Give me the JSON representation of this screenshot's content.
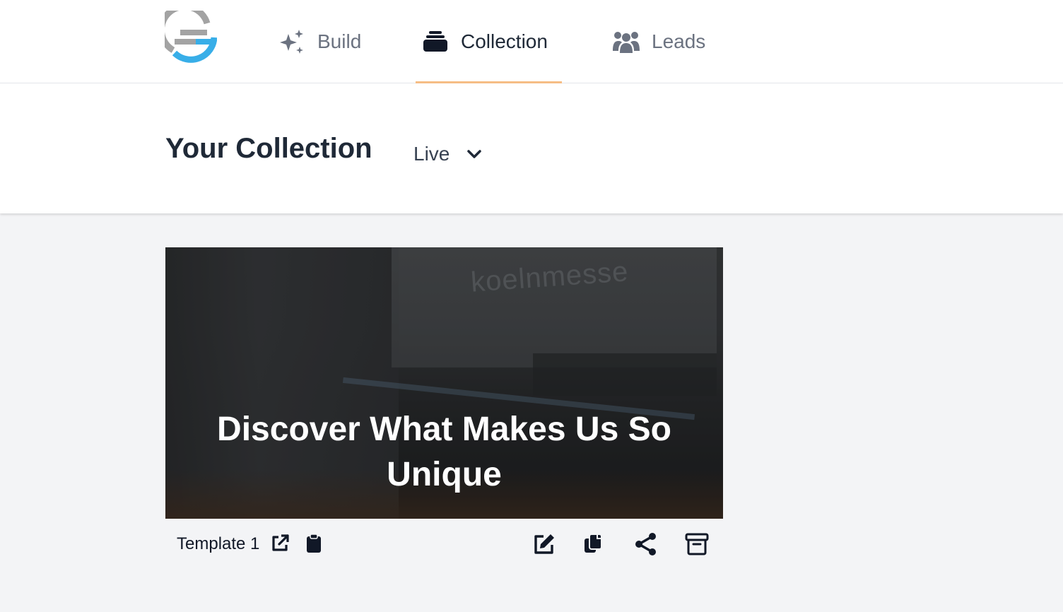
{
  "nav": {
    "tabs": [
      {
        "label": "Build",
        "icon": "sparkles-icon",
        "active": false
      },
      {
        "label": "Collection",
        "icon": "collection-stack-icon",
        "active": true
      },
      {
        "label": "Leads",
        "icon": "users-group-icon",
        "active": false
      }
    ]
  },
  "header": {
    "title": "Your Collection",
    "status_filter": {
      "selected": "Live"
    }
  },
  "collection": {
    "items": [
      {
        "headline": "Discover What Makes Us So Unique",
        "image_text": "koelnmesse",
        "name": "Template 1",
        "actions": [
          "external-link-icon",
          "clipboard-icon",
          "edit-icon",
          "duplicate-icon",
          "share-icon",
          "archive-icon"
        ]
      }
    ]
  },
  "colors": {
    "accent_underline": "#f6bd85",
    "logo_gray": "#9ca3af",
    "logo_blue": "#38aee8",
    "background": "#f3f4f6"
  }
}
